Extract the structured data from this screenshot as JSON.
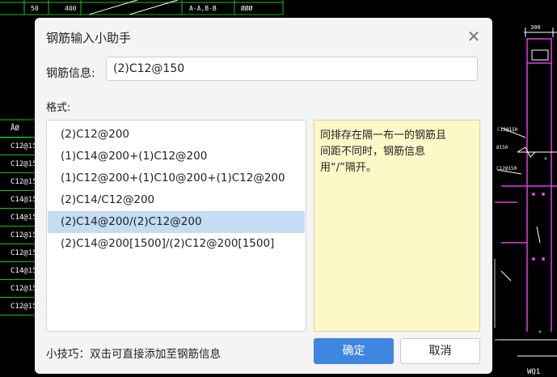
{
  "cad_background": {
    "top_labels": [
      "50",
      "400",
      "A-A,B-B",
      "ØØØ"
    ],
    "left_header": "ÅØ",
    "left_rows": [
      "C12@15",
      "C12@15",
      "C12@15",
      "C14@15",
      "C14@15",
      "C12@15",
      "C12@15",
      "C14@15",
      "C12@15",
      "C12@15"
    ],
    "right_labels": [
      "300",
      "C12@150",
      "Ø150",
      "C12@150"
    ],
    "bottom_right_label": "WQ1"
  },
  "dialog": {
    "title": "钢筋输入小助手",
    "info_label": "钢筋信息:",
    "info_value": "(2)C12@150",
    "format_label": "格式:",
    "format_options": [
      "(2)C12@200",
      "(1)C14@200+(1)C12@200",
      "(1)C12@200+(1)C10@200+(1)C12@200",
      "(2)C14/C12@200",
      "(2)C14@200/(2)C12@200",
      "(2)C14@200[1500]/(2)C12@200[1500]"
    ],
    "selected_option": "(2)C14@200/(2)C12@200",
    "hint_text": "同排存在隔一布一的钢筋且\n间距不同时，钢筋信息\n用“/”隔开。",
    "tip_text": "小技巧：双击可直接添加至钢筋信息",
    "ok_label": "确定",
    "cancel_label": "取消"
  }
}
